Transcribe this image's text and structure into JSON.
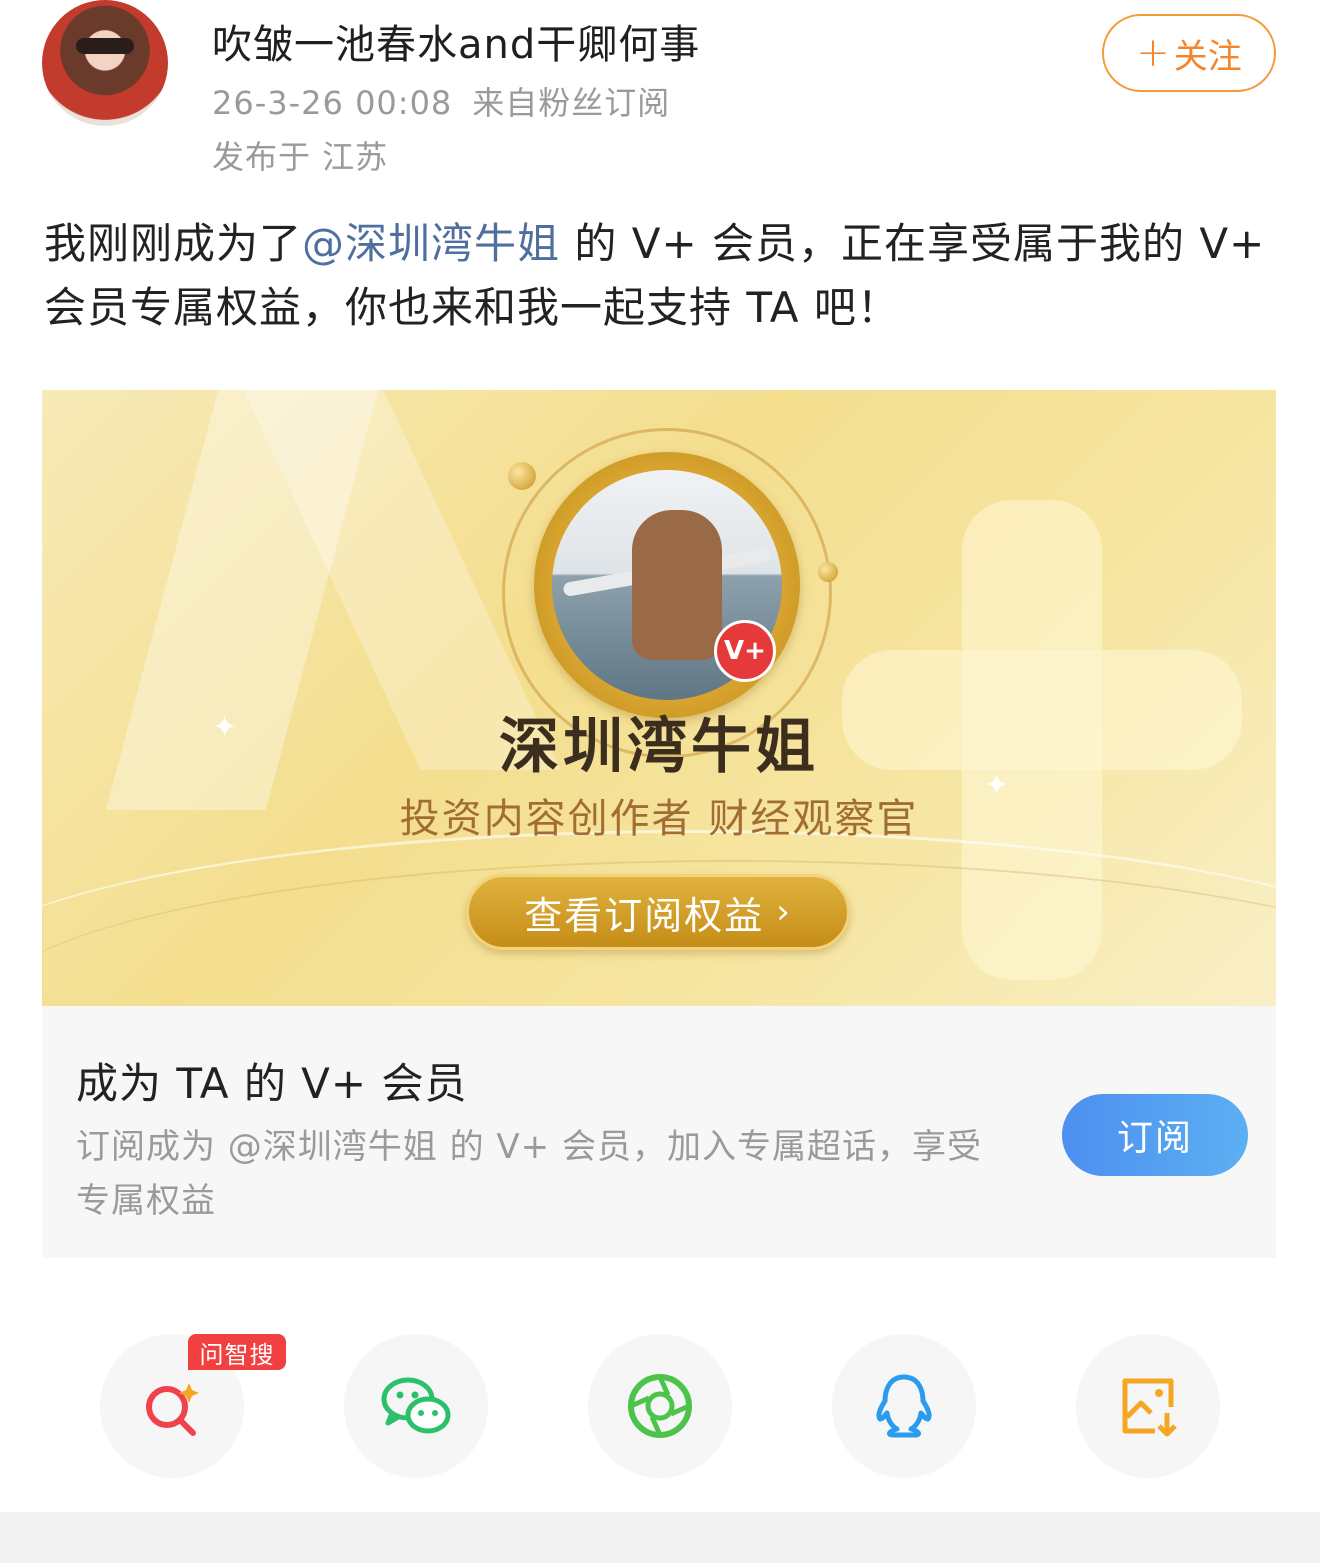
{
  "header": {
    "username": "吹皱一池春水and干卿何事",
    "timestamp": "26-3-26 00:08",
    "source": "来自粉丝订阅",
    "location": "发布于 江苏",
    "follow_label": "关注"
  },
  "post": {
    "text_before": "我刚刚成为了",
    "mention": "@深圳湾牛姐",
    "text_after": " 的 V+ 会员，正在享受属于我的 V+ 会员专属权益，你也来和我一起支持 TA 吧！"
  },
  "card": {
    "creator_name": "深圳湾牛姐",
    "creator_tags": "投资内容创作者 财经观察官",
    "vplus_badge": "V+",
    "benefit_button": "查看订阅权益",
    "title": "成为 TA 的 V+ 会员",
    "description": "订阅成为 @深圳湾牛姐 的 V+ 会员，加入专属超话，享受专属权益",
    "subscribe_label": "订阅"
  },
  "share": {
    "ai_badge": "问智搜",
    "items": [
      {
        "icon": "ai-search-icon",
        "color": "#f0424d"
      },
      {
        "icon": "wechat-icon",
        "color": "#2bc06a"
      },
      {
        "icon": "moments-icon",
        "color": "#4cc44b"
      },
      {
        "icon": "qq-icon",
        "color": "#2a9cf0"
      },
      {
        "icon": "save-image-icon",
        "color": "#f5a623"
      }
    ]
  },
  "colors": {
    "accent_orange": "#f5852a",
    "mention_blue": "#4f6f9e",
    "subscribe_blue": "#4d8ff0",
    "gold": "#c58d17"
  }
}
